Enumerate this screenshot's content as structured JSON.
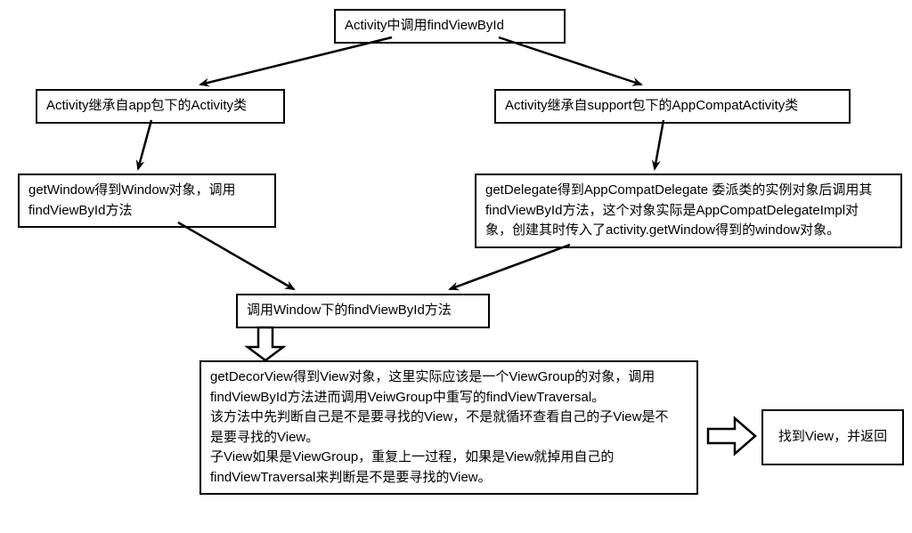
{
  "diagram": {
    "nodes": {
      "root": "Activity中调用findViewById",
      "left1": "Activity继承自app包下的Activity类",
      "right1": "Activity继承自support包下的AppCompatActivity类",
      "left2": "getWindow得到Window对象，调用\nfindViewById方法",
      "right2": "getDelegate得到AppCompatDelegate 委派类的实例对象后调用其\nfindViewById方法，这个对象实际是AppCompatDelegateImpl对\n象，创建其时传入了activity.getWindow得到的window对象。",
      "merge": "调用Window下的findViewById方法",
      "detail": "getDecorView得到View对象，这里实际应该是一个ViewGroup的对象，调用\nfindViewById方法进而调用VeiwGroup中重写的findViewTraversal。\n该方法中先判断自己是不是要寻找的View，不是就循环查看自己的子View是不\n是要寻找的View。\n子View如果是ViewGroup，重复上一过程，如果是View就掉用自己的\nfindViewTraversal来判断是不是要寻找的View。",
      "result": "找到View，并返回"
    },
    "edges": [
      {
        "from": "root",
        "to": "left1"
      },
      {
        "from": "root",
        "to": "right1"
      },
      {
        "from": "left1",
        "to": "left2"
      },
      {
        "from": "right1",
        "to": "right2"
      },
      {
        "from": "left2",
        "to": "merge"
      },
      {
        "from": "right2",
        "to": "merge"
      },
      {
        "from": "merge",
        "to": "detail"
      },
      {
        "from": "detail",
        "to": "result"
      }
    ]
  }
}
